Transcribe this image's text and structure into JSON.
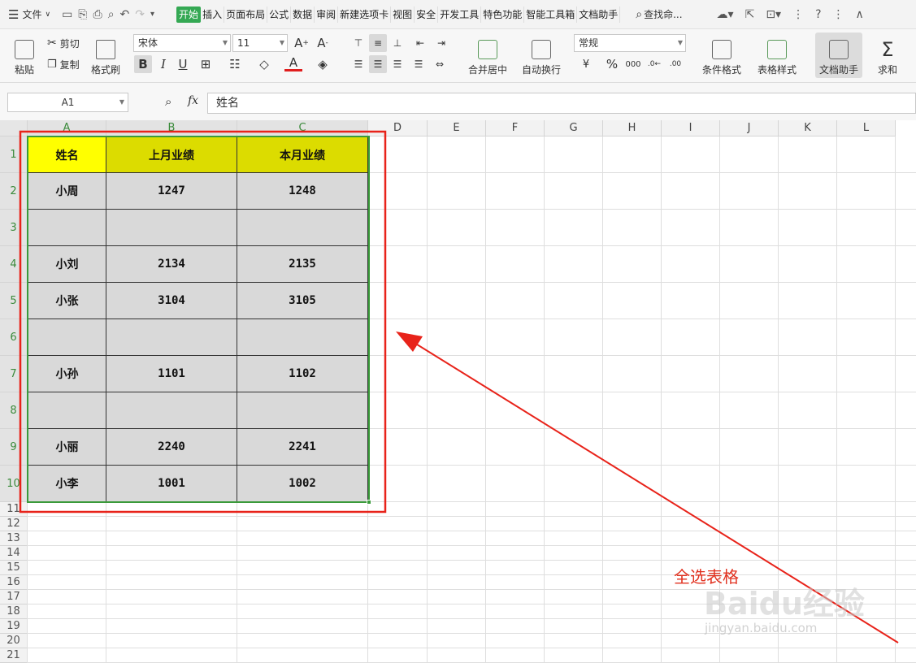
{
  "topbar": {
    "menu_label": "文件",
    "tabs": [
      "开始",
      "插入",
      "页面布局",
      "公式",
      "数据",
      "审阅",
      "新建选项卡",
      "视图",
      "安全",
      "开发工具",
      "特色功能",
      "智能工具箱",
      "文档助手"
    ],
    "active_tab": "开始",
    "search_label": "查找命..."
  },
  "ribbon": {
    "paste_label": "粘贴",
    "cut_label": "剪切",
    "copy_label": "复制",
    "format_painter_label": "格式刷",
    "font_name": "宋体",
    "font_size": "11",
    "merge_label": "合并居中",
    "wrap_label": "自动换行",
    "number_format": "常规",
    "cond_format_label": "条件格式",
    "table_style_label": "表格样式",
    "doc_helper_label": "文档助手",
    "sum_label": "求和"
  },
  "formula_bar": {
    "name_box": "A1",
    "fx_label": "fx",
    "content": "姓名"
  },
  "sheet": {
    "columns": [
      "A",
      "B",
      "C",
      "D",
      "E",
      "F",
      "G",
      "H",
      "I",
      "J",
      "K",
      "L"
    ],
    "rows": [
      "1",
      "2",
      "3",
      "4",
      "5",
      "6",
      "7",
      "8",
      "9",
      "10",
      "11",
      "12",
      "13",
      "14",
      "15",
      "16",
      "17",
      "18",
      "19",
      "20",
      "21"
    ],
    "headers": [
      "姓名",
      "上月业绩",
      "本月业绩"
    ],
    "data": [
      [
        "小周",
        "1247",
        "1248"
      ],
      [
        "",
        "",
        ""
      ],
      [
        "小刘",
        "2134",
        "2135"
      ],
      [
        "小张",
        "3104",
        "3105"
      ],
      [
        "",
        "",
        ""
      ],
      [
        "小孙",
        "1101",
        "1102"
      ],
      [
        "",
        "",
        ""
      ],
      [
        "小丽",
        "2240",
        "2241"
      ],
      [
        "小李",
        "1001",
        "1002"
      ]
    ],
    "header_color_first": "#ffff00",
    "header_color": "#dcdc00",
    "body_color": "#d9d9d9",
    "selection_color": "#3a9a3a"
  },
  "annotation": {
    "text": "全选表格",
    "color": "#e1301e"
  },
  "watermark": {
    "text": "Baidu经验",
    "url_text": "jingyan.baidu.com"
  }
}
